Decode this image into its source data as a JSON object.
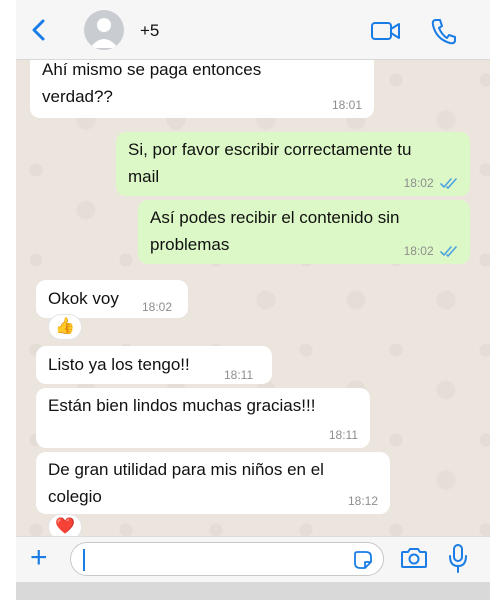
{
  "header": {
    "contact_name": "+5",
    "back_icon": "chevron-left-icon",
    "avatar_icon": "person-avatar-icon",
    "video_icon": "video-camera-icon",
    "call_icon": "phone-icon"
  },
  "messages": [
    {
      "direction": "in",
      "text_lines": [
        "Ahí mismo se paga entonces",
        "verdad??"
      ],
      "time": "18:01"
    },
    {
      "direction": "out",
      "text_lines": [
        "Si, por favor escribir correctamente tu",
        "mail"
      ],
      "time": "18:02",
      "status": "read"
    },
    {
      "direction": "out",
      "text_lines": [
        "Así podes recibir el contenido sin",
        "problemas"
      ],
      "time": "18:02",
      "status": "read"
    },
    {
      "direction": "in",
      "text_lines": [
        "Okok voy"
      ],
      "time": "18:02",
      "reaction": "👍"
    },
    {
      "direction": "in",
      "text_lines": [
        "Listo ya los tengo!!"
      ],
      "time": "18:11"
    },
    {
      "direction": "in",
      "text_lines": [
        "Están bien lindos muchas gracias!!!"
      ],
      "time": "18:11"
    },
    {
      "direction": "in",
      "text_lines": [
        "De gran utilidad para mis niños en el",
        "colegio"
      ],
      "time": "18:12",
      "reaction": "❤️"
    }
  ],
  "input_bar": {
    "plus_label": "+",
    "message_value": "",
    "sticker_icon": "sticker-icon",
    "camera_icon": "camera-icon",
    "mic_icon": "microphone-icon"
  },
  "colors": {
    "accent": "#1a7de6",
    "incoming_bubble": "#ffffff",
    "outgoing_bubble": "#dcf8c6",
    "read_ticks": "#4fa3e0",
    "wallpaper": "#ece5dd"
  }
}
